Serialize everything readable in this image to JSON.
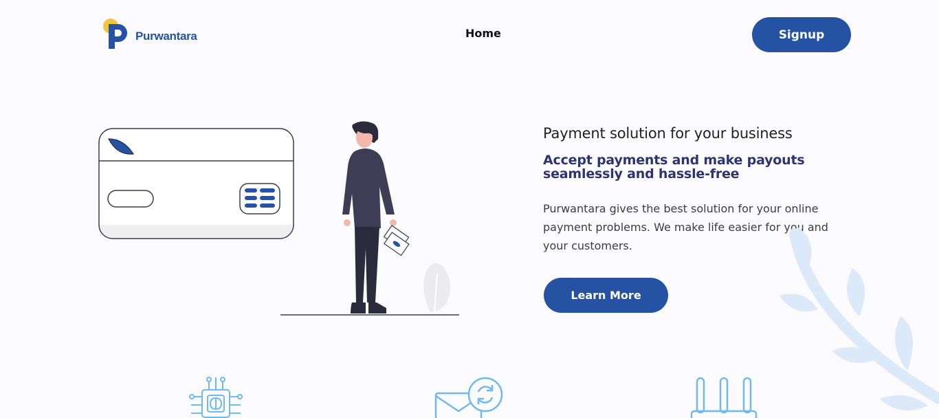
{
  "header": {
    "brand_name": "Purwantara",
    "nav": {
      "home_label": "Home"
    },
    "signup_label": "Signup"
  },
  "hero": {
    "title": "Payment solution for your business",
    "subtitle": "Accept payments and make payouts seamlessly and hassle-free",
    "description": "Purwantara gives the best solution for your online payment problems. We make life easier for you and your customers.",
    "cta_label": "Learn More"
  },
  "features": {
    "icons": [
      "chip-brain-icon",
      "email-refresh-icon",
      "router-icon"
    ]
  },
  "colors": {
    "brand_blue": "#2552a3",
    "brand_yellow": "#f5c342",
    "subtitle_navy": "#2d3470",
    "icon_light_blue": "#6fb8f0",
    "decor_light_blue": "#dce9f8"
  }
}
